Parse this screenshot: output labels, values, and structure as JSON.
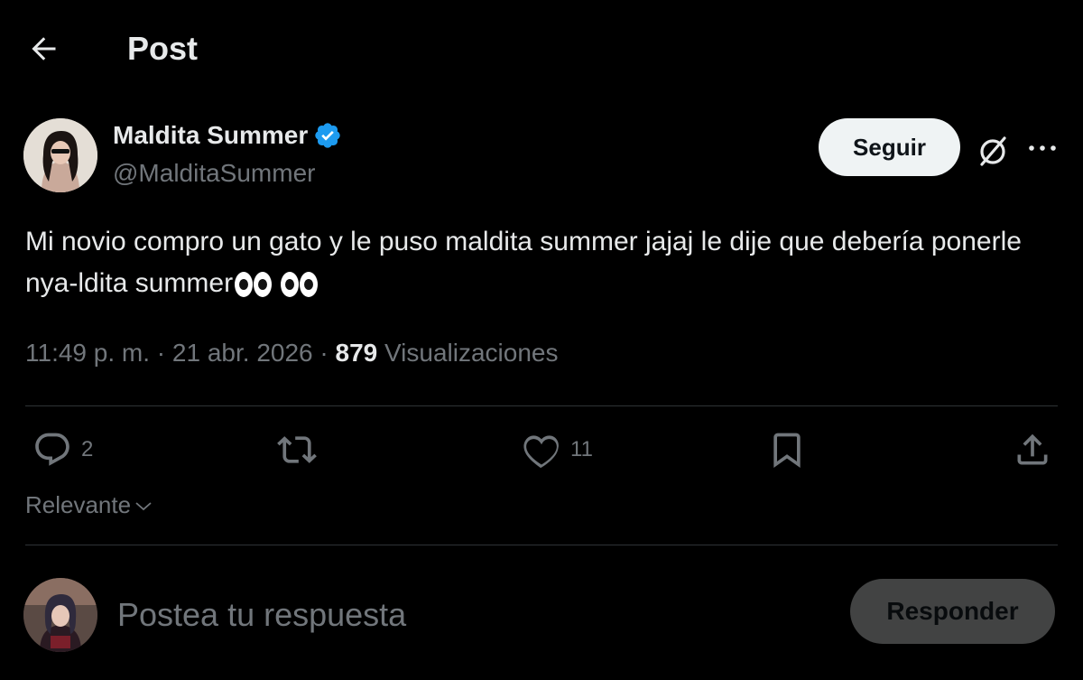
{
  "header": {
    "title": "Post",
    "back_icon": "arrow-left-icon"
  },
  "author": {
    "display_name": "Maldita Summer",
    "handle": "@MalditaSummer",
    "verified_color": "#1d9bf0"
  },
  "follow_label": "Seguir",
  "tweet": {
    "text": "Mi novio compro un gato y le puso maldita summer jajaj le dije que debería ponerle nya-ldita summer",
    "emoji": "👀👀"
  },
  "meta": {
    "time": "11:49 p. m.",
    "date": "21 abr. 2026",
    "views_count": "879",
    "views_label": "Visualizaciones"
  },
  "actions": {
    "replies": "2",
    "likes": "11"
  },
  "sort": {
    "label": "Relevante"
  },
  "composer": {
    "placeholder": "Postea tu respuesta",
    "button_label": "Responder"
  },
  "colors": {
    "background": "#000000",
    "text": "#e7e9ea",
    "muted": "#71767b",
    "divider": "#2f3336"
  }
}
